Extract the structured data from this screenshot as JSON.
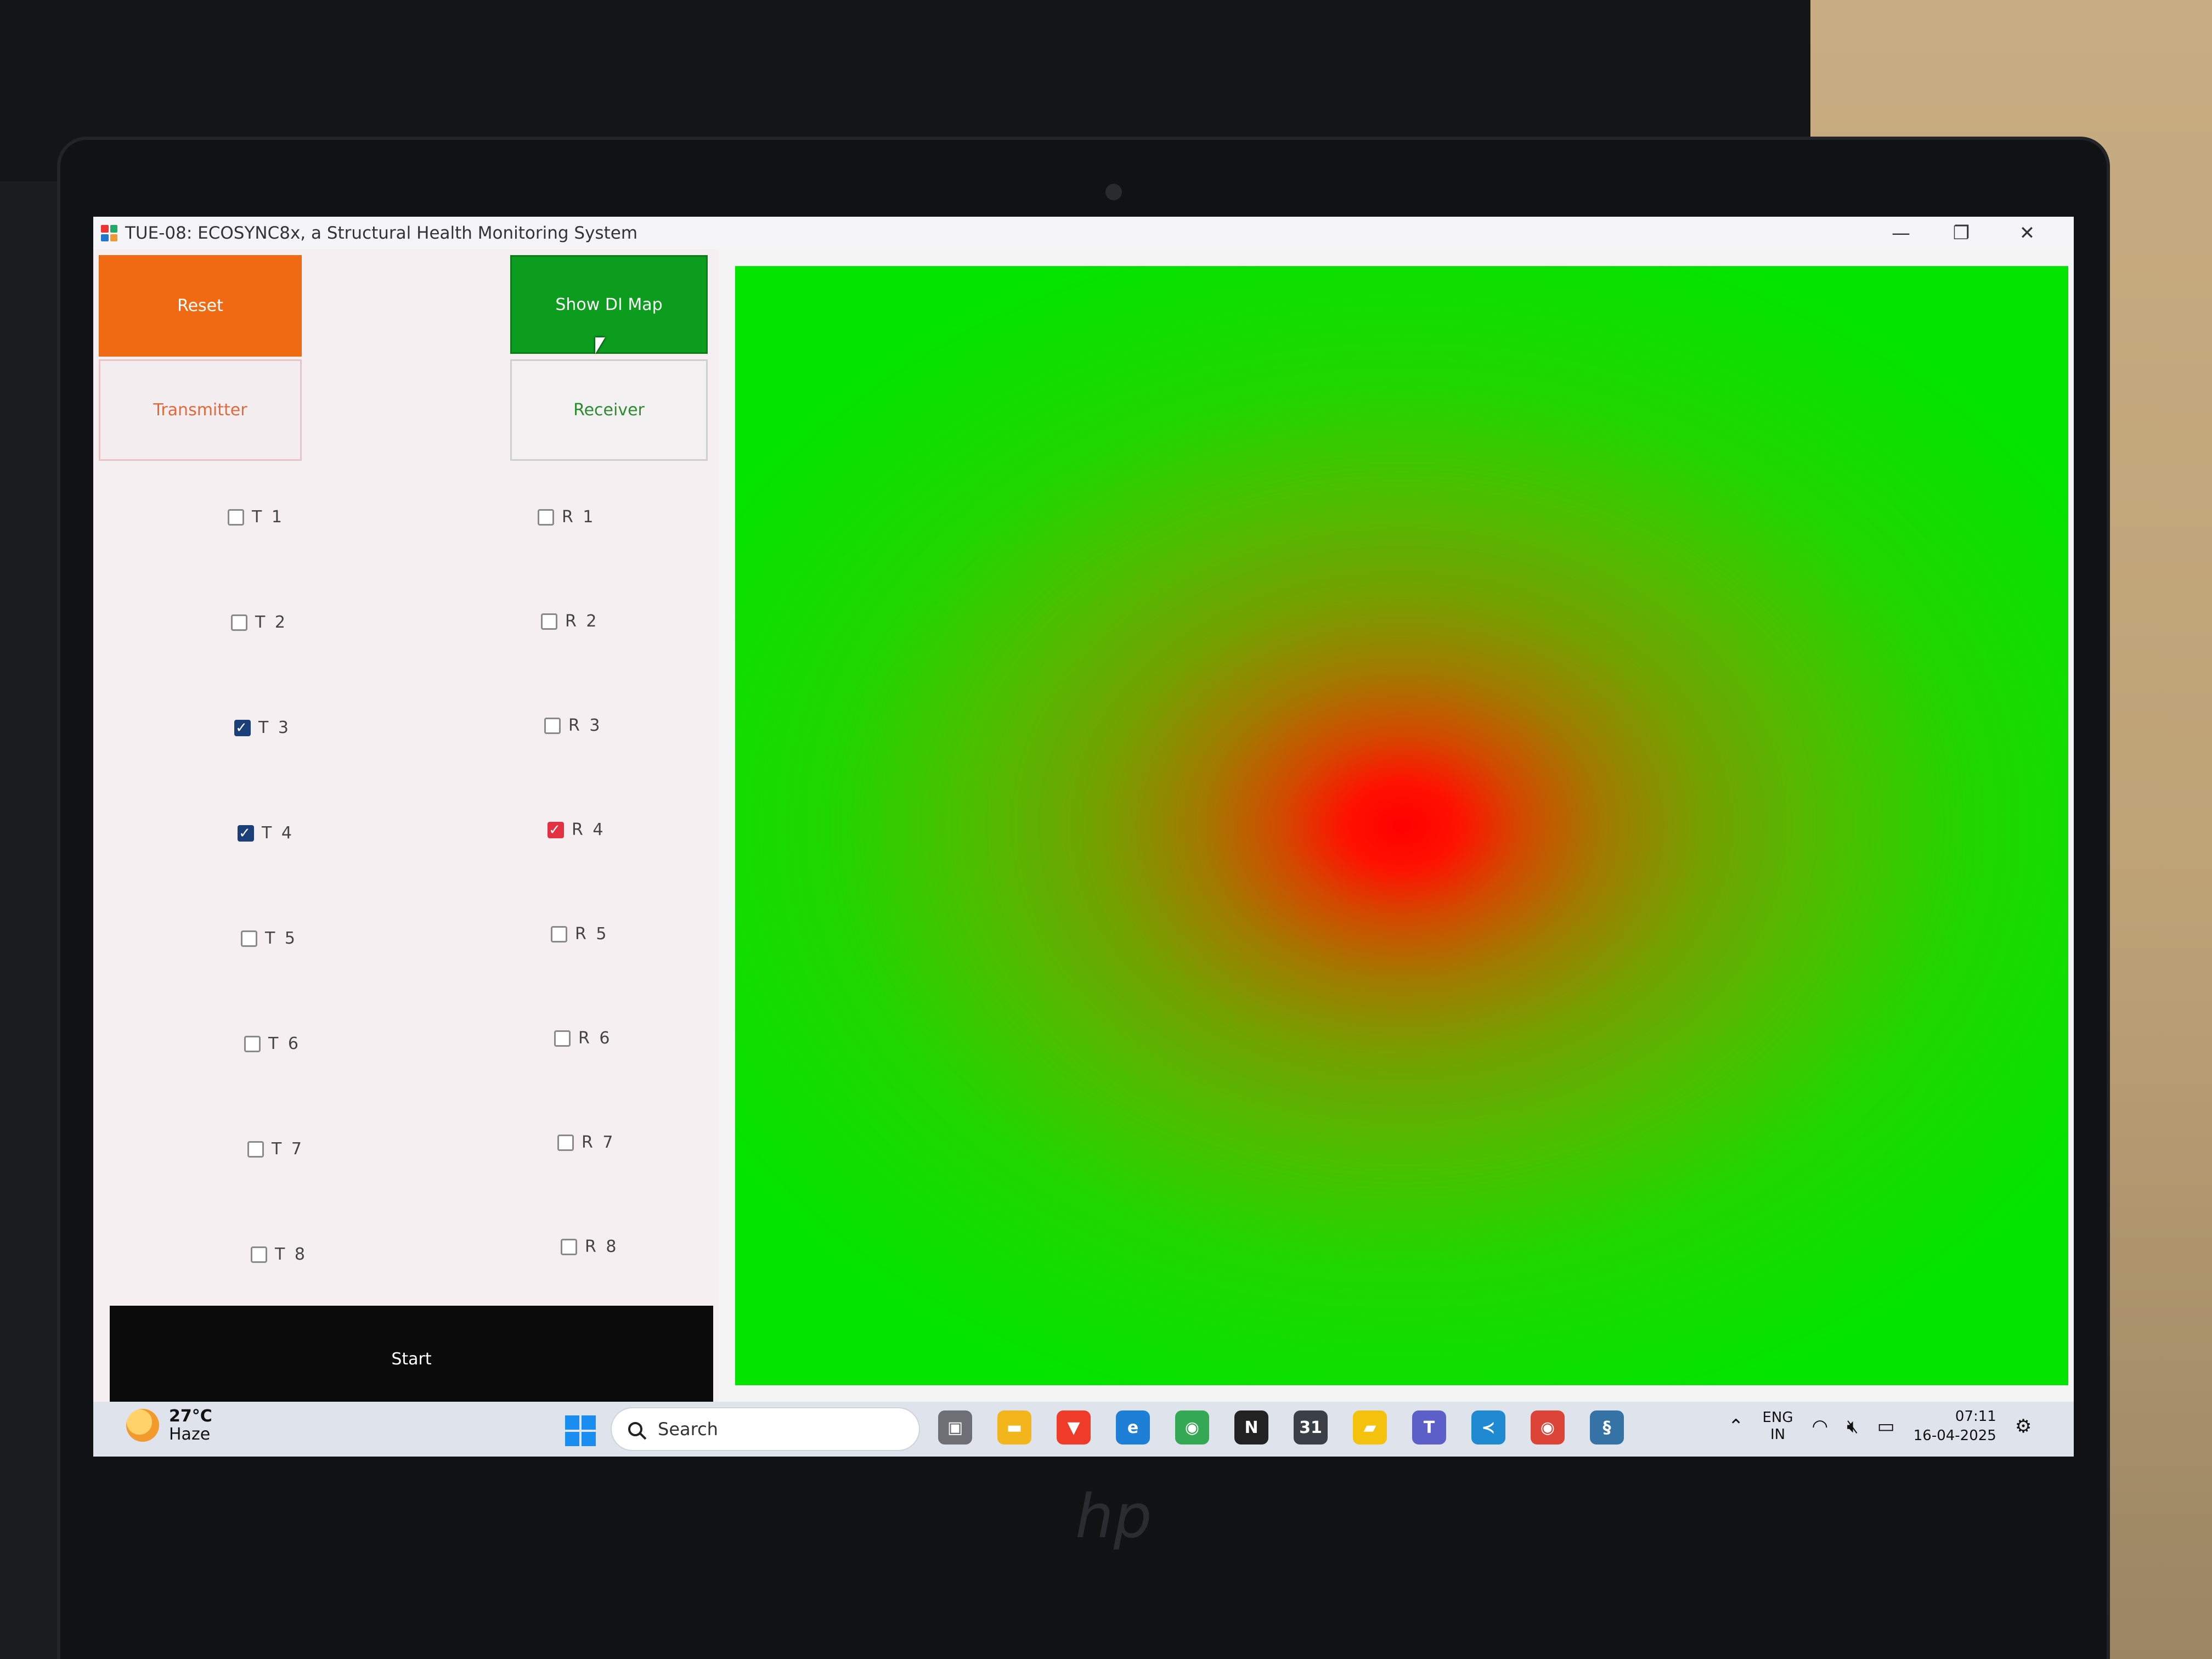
{
  "window": {
    "title": "TUE-08: ECOSYNC8x, a Structural Health Monitoring System",
    "controls": {
      "minimize": "—",
      "restore": "❐",
      "close": "✕"
    }
  },
  "buttons": {
    "reset": "Reset",
    "show_di_map": "Show DI Map",
    "transmitter": "Transmitter",
    "receiver": "Receiver",
    "start": "Start"
  },
  "transmitters": [
    {
      "label": "T 1",
      "checked": false
    },
    {
      "label": "T 2",
      "checked": false
    },
    {
      "label": "T 3",
      "checked": true
    },
    {
      "label": "T 4",
      "checked": true
    },
    {
      "label": "T 5",
      "checked": false
    },
    {
      "label": "T 6",
      "checked": false
    },
    {
      "label": "T 7",
      "checked": false
    },
    {
      "label": "T 8",
      "checked": false
    }
  ],
  "receivers": [
    {
      "label": "R 1",
      "checked": false
    },
    {
      "label": "R 2",
      "checked": false
    },
    {
      "label": "R 3",
      "checked": false
    },
    {
      "label": "R 4",
      "checked": true
    },
    {
      "label": "R 5",
      "checked": false
    },
    {
      "label": "R 6",
      "checked": false
    },
    {
      "label": "R 7",
      "checked": false
    },
    {
      "label": "R 8",
      "checked": false
    }
  ],
  "di_map": {
    "hotspot_color": "#ff0000",
    "background_color": "#03e400"
  },
  "taskbar": {
    "weather": {
      "temp": "27°C",
      "condition": "Haze"
    },
    "search_placeholder": "Search",
    "lang_line1": "ENG",
    "lang_line2": "IN",
    "time": "07:11",
    "date": "16-04-2025",
    "pinned": [
      {
        "name": "task-view-icon",
        "glyph": "▣",
        "color": "#6d6f75"
      },
      {
        "name": "file-explorer-icon",
        "glyph": "▬",
        "color": "#f2b51c"
      },
      {
        "name": "brave-icon",
        "glyph": "▼",
        "color": "#ef3b2a"
      },
      {
        "name": "edge-icon",
        "glyph": "e",
        "color": "#1e7fd6"
      },
      {
        "name": "chrome-icon",
        "glyph": "◉",
        "color": "#34a853"
      },
      {
        "name": "notion-icon",
        "glyph": "N",
        "color": "#222222"
      },
      {
        "name": "calendar-icon",
        "glyph": "31",
        "color": "#3b3f47"
      },
      {
        "name": "sticky-notes-icon",
        "glyph": "▰",
        "color": "#f4c20d"
      },
      {
        "name": "teams-icon",
        "glyph": "T",
        "color": "#5b5fc7"
      },
      {
        "name": "vscode-icon",
        "glyph": "≺",
        "color": "#1f8ad2"
      },
      {
        "name": "chrome-profile-icon",
        "glyph": "◉",
        "color": "#db4437"
      },
      {
        "name": "python-app-icon",
        "glyph": "§",
        "color": "#3572a5"
      }
    ]
  }
}
